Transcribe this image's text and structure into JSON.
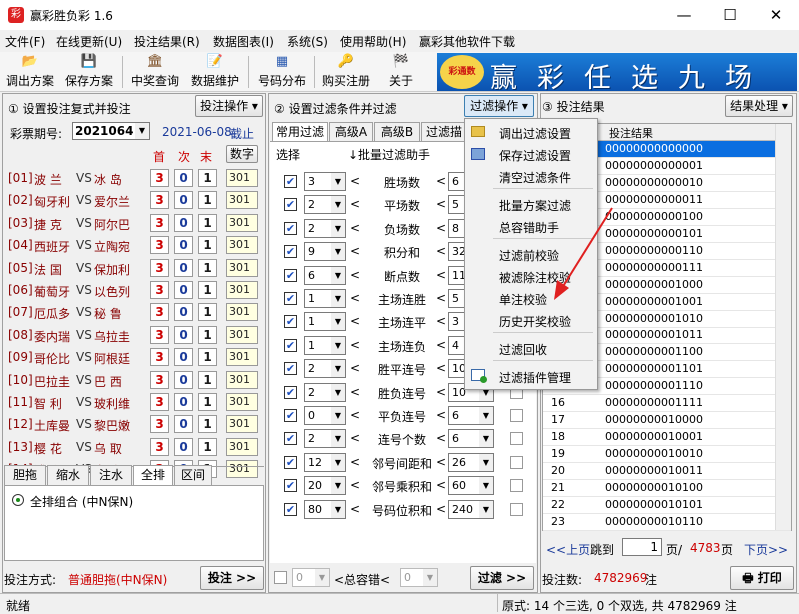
{
  "window": {
    "title": "赢彩胜负彩 1.6"
  },
  "menu": [
    "文件(F)",
    "在线更新(U)",
    "投注结果(R)",
    "数据图表(I)",
    "系统(S)",
    "使用帮助(H)",
    "赢彩其他软件下载"
  ],
  "toolbar": [
    "调出方案",
    "保存方案",
    "中奖查询",
    "数据维护",
    "号码分布",
    "购买注册",
    "关于"
  ],
  "banner": {
    "logo": "彩通数",
    "text": "赢彩任选九场"
  },
  "left": {
    "title": "① 设置投注复式并投注",
    "op_button": "投注操作 ▾",
    "period_label": "彩票期号:",
    "period": "2021064",
    "date": "2021-06-08",
    "deadline": "截止",
    "col_first": "首",
    "col_second": "次",
    "col_last": "末",
    "col_num_button": "数字",
    "matches": [
      {
        "idx": "[01]",
        "home": "波 兰",
        "away": "冰 岛",
        "a": "3",
        "b": "0",
        "c": "1",
        "n": "301"
      },
      {
        "idx": "[02]",
        "home": "匈牙利",
        "away": "爱尔兰",
        "a": "3",
        "b": "0",
        "c": "1",
        "n": "301"
      },
      {
        "idx": "[03]",
        "home": "捷 克",
        "away": "阿尔巴",
        "a": "3",
        "b": "0",
        "c": "1",
        "n": "301"
      },
      {
        "idx": "[04]",
        "home": "西班牙",
        "away": "立陶宛",
        "a": "3",
        "b": "0",
        "c": "1",
        "n": "301"
      },
      {
        "idx": "[05]",
        "home": "法 国",
        "away": "保加利",
        "a": "3",
        "b": "0",
        "c": "1",
        "n": "301"
      },
      {
        "idx": "[06]",
        "home": "葡萄牙",
        "away": "以色列",
        "a": "3",
        "b": "0",
        "c": "1",
        "n": "301"
      },
      {
        "idx": "[07]",
        "home": "厄瓜多",
        "away": "秘 鲁",
        "a": "3",
        "b": "0",
        "c": "1",
        "n": "301"
      },
      {
        "idx": "[08]",
        "home": "委内瑞",
        "away": "乌拉圭",
        "a": "3",
        "b": "0",
        "c": "1",
        "n": "301"
      },
      {
        "idx": "[09]",
        "home": "哥伦比",
        "away": "阿根廷",
        "a": "3",
        "b": "0",
        "c": "1",
        "n": "301"
      },
      {
        "idx": "[10]",
        "home": "巴拉圭",
        "away": "巴 西",
        "a": "3",
        "b": "0",
        "c": "1",
        "n": "301"
      },
      {
        "idx": "[11]",
        "home": "智 利",
        "away": "玻利维",
        "a": "3",
        "b": "0",
        "c": "1",
        "n": "301"
      },
      {
        "idx": "[12]",
        "home": "土库曼",
        "away": "黎巴嫩",
        "a": "3",
        "b": "0",
        "c": "1",
        "n": "301"
      },
      {
        "idx": "[13]",
        "home": "樱 花",
        "away": "乌 取",
        "a": "3",
        "b": "0",
        "c": "1",
        "n": "301"
      },
      {
        "idx": "[14]",
        "home": "浦 和",
        "away": "富 山",
        "a": "3",
        "b": "0",
        "c": "1",
        "n": "301"
      }
    ],
    "vs": "VS",
    "tabs": [
      "胆拖",
      "缩水",
      "注水",
      "全排",
      "区间"
    ],
    "radio_label": "全排组合  (中N保N)",
    "method_label": "投注方式:",
    "method_value": "普通胆拖(中N保N)",
    "bet_button": "投注 >>"
  },
  "middle": {
    "title": "② 设置过滤条件并过滤",
    "op_button": "过滤操作 ▾",
    "tabs": [
      "常用过滤",
      "高级A",
      "高级B",
      "过滤描"
    ],
    "select_label": "选择",
    "batch_label": "↓批量过滤助手",
    "filters": [
      {
        "min": "3",
        "name": "胜场数",
        "max": "6"
      },
      {
        "min": "2",
        "name": "平场数",
        "max": "5"
      },
      {
        "min": "2",
        "name": "负场数",
        "max": "8"
      },
      {
        "min": "9",
        "name": "积分和",
        "max": "32"
      },
      {
        "min": "6",
        "name": "断点数",
        "max": "11"
      },
      {
        "min": "1",
        "name": "主场连胜",
        "max": "5"
      },
      {
        "min": "1",
        "name": "主场连平",
        "max": "3"
      },
      {
        "min": "1",
        "name": "主场连负",
        "max": "4"
      },
      {
        "min": "2",
        "name": "胜平连号",
        "max": "10"
      },
      {
        "min": "2",
        "name": "胜负连号",
        "max": "10"
      },
      {
        "min": "0",
        "name": "平负连号",
        "max": "6"
      },
      {
        "min": "2",
        "name": "连号个数",
        "max": "6"
      },
      {
        "min": "12",
        "name": "邻号间距和",
        "max": "26"
      },
      {
        "min": "20",
        "name": "邻号乘积和",
        "max": "60"
      },
      {
        "min": "80",
        "name": "号码位积和",
        "max": "240"
      }
    ],
    "lt": "<",
    "bottom_min": "0",
    "bottom_label": "<总容错<",
    "bottom_max": "0",
    "filter_button": "过滤 >>"
  },
  "dropdown": [
    "调出过滤设置",
    "保存过滤设置",
    "清空过滤条件",
    "批量方案过滤",
    "总容错助手",
    "过滤前校验",
    "被滤除注校验",
    "单注校验",
    "历史开奖校验",
    "过滤回收",
    "过滤插件管理"
  ],
  "right": {
    "title": "③ 投注结果",
    "op_button": "结果处理 ▾",
    "col_header": "投注结果",
    "rows": [
      {
        "no": "",
        "val": "00000000000000"
      },
      {
        "no": "",
        "val": "00000000000001"
      },
      {
        "no": "",
        "val": "00000000000010"
      },
      {
        "no": "",
        "val": "00000000000011"
      },
      {
        "no": "",
        "val": "00000000000100"
      },
      {
        "no": "",
        "val": "00000000000101"
      },
      {
        "no": "",
        "val": "00000000000110"
      },
      {
        "no": "",
        "val": "00000000000111"
      },
      {
        "no": "",
        "val": "00000000001000"
      },
      {
        "no": "",
        "val": "00000000001001"
      },
      {
        "no": "",
        "val": "00000000001010"
      },
      {
        "no": "",
        "val": "00000000001011"
      },
      {
        "no": "",
        "val": "00000000001100"
      },
      {
        "no": "",
        "val": "00000000001101"
      },
      {
        "no": "",
        "val": "00000000001110"
      },
      {
        "no": "16",
        "val": "00000000001111"
      },
      {
        "no": "17",
        "val": "00000000010000"
      },
      {
        "no": "18",
        "val": "00000000010001"
      },
      {
        "no": "19",
        "val": "00000000010010"
      },
      {
        "no": "20",
        "val": "00000000010011"
      },
      {
        "no": "21",
        "val": "00000000010100"
      },
      {
        "no": "22",
        "val": "00000000010101"
      },
      {
        "no": "23",
        "val": "00000000010110"
      }
    ],
    "prev": "<<上页",
    "jump": "跳到",
    "page": "1",
    "page_sep": "页/",
    "total_pages": "4783",
    "page_unit": "页",
    "next": "下页>>",
    "count_label": "投注数:",
    "count": "4782969",
    "count_unit": "注",
    "print_button": "打印"
  },
  "status": {
    "left": "就绪",
    "right": "原式: 14 个三选, 0 个双选, 共 4782969 注"
  }
}
